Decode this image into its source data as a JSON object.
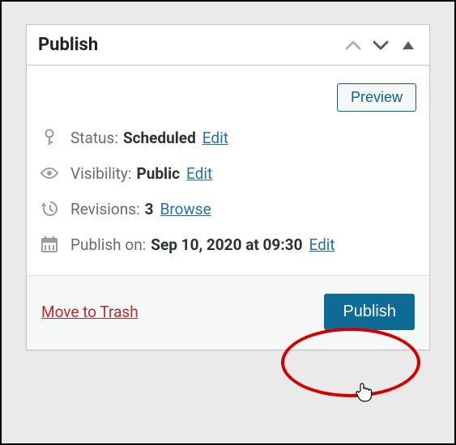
{
  "header": {
    "title": "Publish"
  },
  "preview": {
    "label": "Preview"
  },
  "status": {
    "label": "Status:",
    "value": "Scheduled",
    "edit": "Edit"
  },
  "visibility": {
    "label": "Visibility:",
    "value": "Public",
    "edit": "Edit"
  },
  "revisions": {
    "label": "Revisions:",
    "value": "3",
    "browse": "Browse"
  },
  "schedule": {
    "label": "Publish on:",
    "value": "Sep 10, 2020 at 09:30",
    "edit": "Edit"
  },
  "footer": {
    "trash": "Move to Trash",
    "submit": "Publish"
  }
}
